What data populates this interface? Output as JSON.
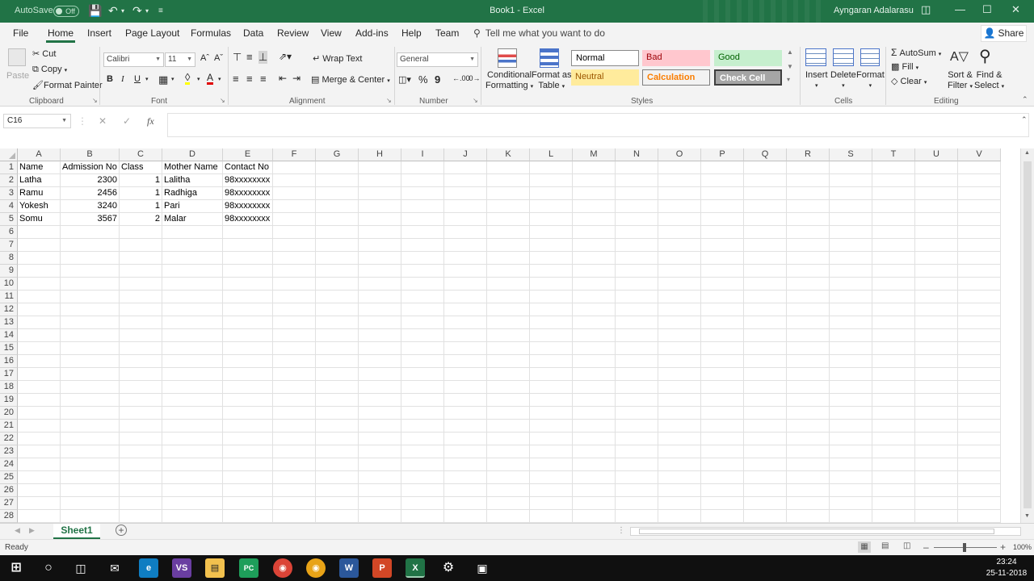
{
  "titlebar": {
    "autosave_label": "AutoSave",
    "autosave_state": "Off",
    "title": "Book1  -  Excel",
    "user": "Ayngaran Adalarasu"
  },
  "tabs": [
    "File",
    "Home",
    "Insert",
    "Page Layout",
    "Formulas",
    "Data",
    "Review",
    "View",
    "Add-ins",
    "Help",
    "Team"
  ],
  "active_tab": "Home",
  "tell_me": "Tell me what you want to do",
  "share": "Share",
  "ribbon": {
    "clipboard": {
      "paste": "Paste",
      "cut": "Cut",
      "copy": "Copy",
      "format_painter": "Format Painter",
      "label": "Clipboard"
    },
    "font": {
      "name": "Calibri",
      "size": "11",
      "bold": "B",
      "italic": "I",
      "underline": "U",
      "label": "Font"
    },
    "alignment": {
      "wrap_text": "Wrap Text",
      "merge_center": "Merge & Center",
      "label": "Alignment"
    },
    "number": {
      "format": "General",
      "label": "Number"
    },
    "styles": {
      "conditional_formatting": [
        "Conditional",
        "Formatting"
      ],
      "format_as_table": [
        "Format as",
        "Table"
      ],
      "normal": "Normal",
      "bad": "Bad",
      "good": "Good",
      "neutral": "Neutral",
      "calculation": "Calculation",
      "check_cell": "Check Cell",
      "label": "Styles"
    },
    "cells": {
      "insert": "Insert",
      "delete": "Delete",
      "format": "Format",
      "label": "Cells"
    },
    "editing": {
      "autosum": "AutoSum",
      "fill": "Fill",
      "clear": "Clear",
      "sort_filter": [
        "Sort &",
        "Filter"
      ],
      "find_select": [
        "Find &",
        "Select"
      ],
      "label": "Editing"
    }
  },
  "namebox": "C16",
  "columns": [
    "A",
    "B",
    "C",
    "D",
    "E",
    "F",
    "G",
    "H",
    "I",
    "J",
    "K",
    "L",
    "M",
    "N",
    "O",
    "P",
    "Q",
    "R",
    "S",
    "T",
    "U",
    "V"
  ],
  "rows": [
    [
      "Name",
      "Admission No",
      "Class",
      "Mother Name",
      "Contact No"
    ],
    [
      "Latha",
      "2300",
      "1",
      "Lalitha",
      "98xxxxxxxx"
    ],
    [
      "Ramu",
      "2456",
      "1",
      "Radhiga",
      "98xxxxxxxx"
    ],
    [
      "Yokesh",
      "3240",
      "1",
      "Pari",
      "98xxxxxxxx"
    ],
    [
      "Somu",
      "3567",
      "2",
      "Malar",
      "98xxxxxxxx"
    ]
  ],
  "row_count": 28,
  "sheet_tab": "Sheet1",
  "status": "Ready",
  "zoom": "100%",
  "clock": {
    "time": "23:24",
    "date": "25-11-2018"
  },
  "colors": {
    "excel_green": "#217346",
    "bad_bg": "#ffc7ce",
    "good_bg": "#c6efce",
    "neutral_bg": "#ffeb9c",
    "check_cell_bg": "#a5a5a5"
  }
}
